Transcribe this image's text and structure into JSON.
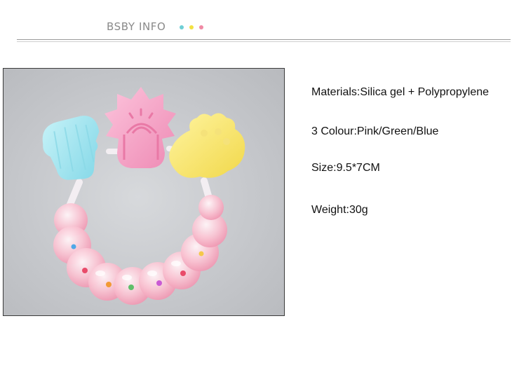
{
  "header": {
    "title": "BSBY INFO",
    "dot_colors": [
      "#6fcfd6",
      "#f2e142",
      "#f08aa4"
    ]
  },
  "product": {
    "image_icon": "baby-teether-rattle",
    "specs": {
      "materials": "Materials:Silica gel + Polypropylene",
      "colour": "3 Colour:Pink/Green/Blue",
      "size": "Size:9.5*7CM",
      "weight": "Weight:30g"
    }
  },
  "colors": {
    "pink": "#f4a6c6",
    "blue": "#9ee3ef",
    "yellow": "#f7e36a",
    "bead_pink": "#f7b6c8"
  }
}
